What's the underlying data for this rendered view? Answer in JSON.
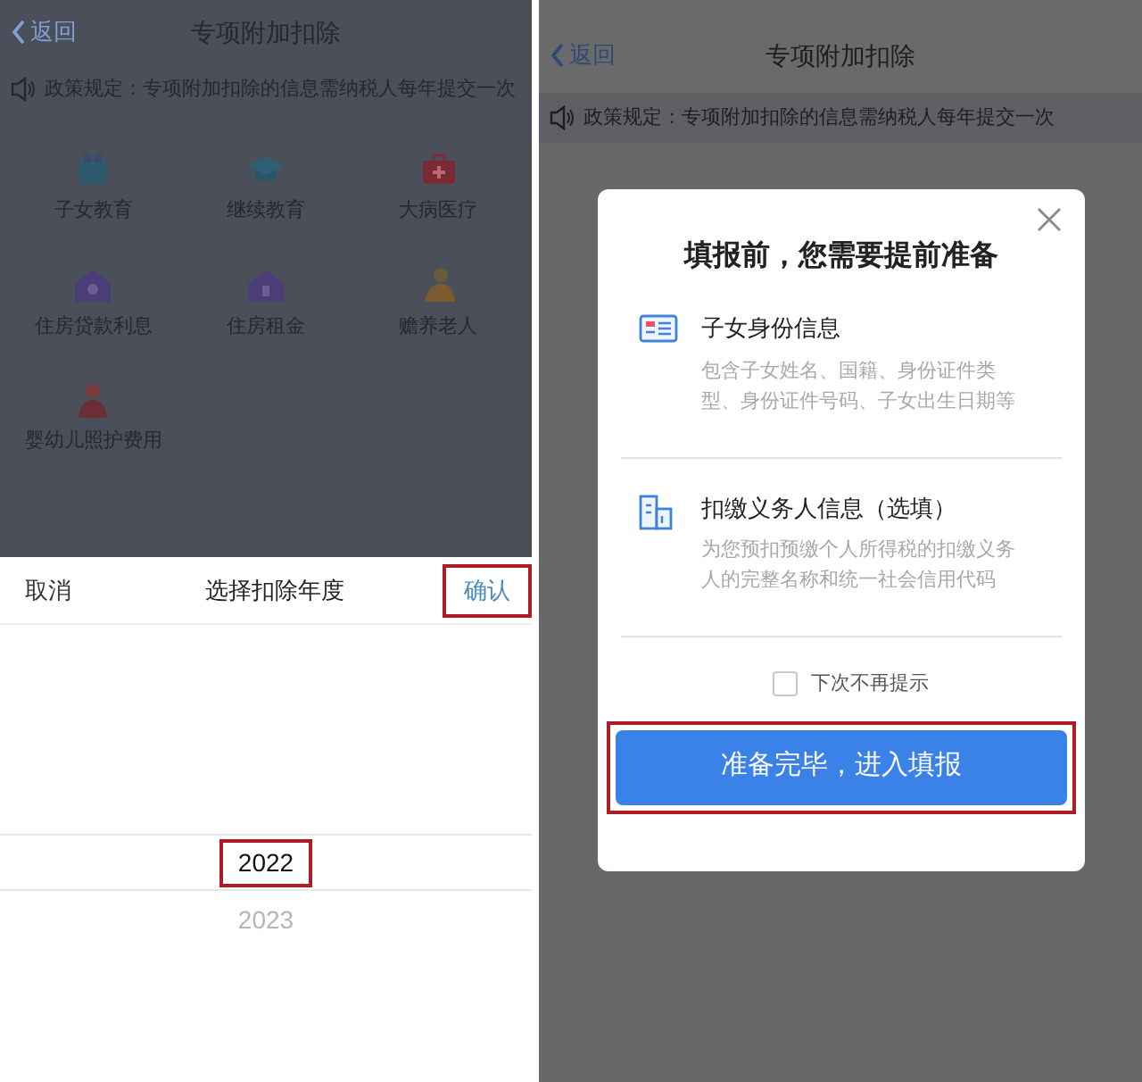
{
  "left_screen": {
    "header": {
      "back": "返回",
      "title": "专项附加扣除"
    },
    "notice": "政策规定：专项附加扣除的信息需纳税人每年提交一次",
    "categories": [
      {
        "kind": "children",
        "label": "子女教育"
      },
      {
        "kind": "education",
        "label": "继续教育"
      },
      {
        "kind": "illness",
        "label": "大病医疗"
      },
      {
        "kind": "loan",
        "label": "住房贷款利息"
      },
      {
        "kind": "rent",
        "label": "住房租金"
      },
      {
        "kind": "elderly",
        "label": "赡养老人"
      },
      {
        "kind": "infant",
        "label": "婴幼儿照护费用"
      }
    ],
    "picker": {
      "cancel": "取消",
      "title": "选择扣除年度",
      "confirm": {
        "label": "确认",
        "highlighted": true
      },
      "options": [
        {
          "label": "2022",
          "selected": true,
          "highlighted": true
        },
        {
          "label": "2023",
          "selected": false,
          "highlighted": false
        }
      ]
    }
  },
  "right_screen": {
    "header": {
      "back": "返回",
      "title": "专项附加扣除"
    },
    "notice": "政策规定：专项附加扣除的信息需纳税人每年提交一次",
    "dialog": {
      "title": "填报前，您需要提前准备",
      "items": [
        {
          "kind": "id_card",
          "title": "子女身份信息",
          "description": "包含子女姓名、国籍、身份证件类型、身份证件号码、子女出生日期等"
        },
        {
          "kind": "building",
          "title": "扣缴义务人信息（选填）",
          "description": "为您预扣预缴个人所得税的扣缴义务人的完整名称和统一社会信用代码"
        }
      ],
      "checkbox": {
        "label": "下次不再提示",
        "checked": false
      },
      "button": {
        "label": "准备完毕，进入填报",
        "highlighted": true
      }
    }
  }
}
